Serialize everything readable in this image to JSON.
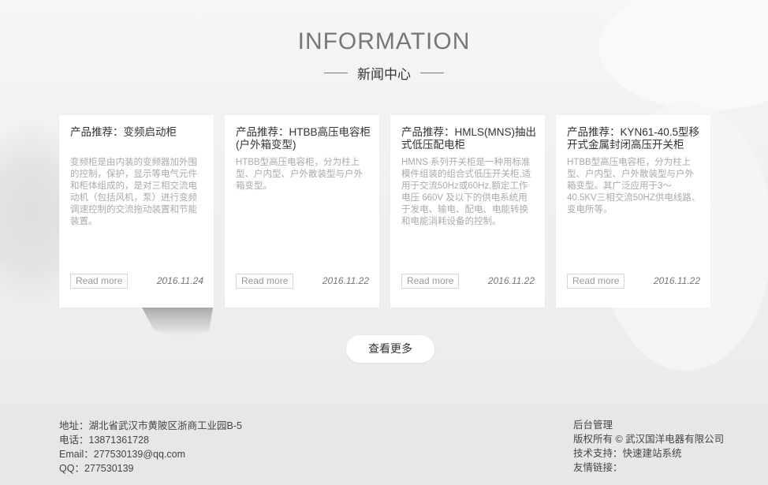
{
  "section": {
    "heading": "INFORMATION",
    "subheading": "新闻中心"
  },
  "cards": [
    {
      "title": "产品推荐：变频启动柜",
      "description": "变频柜是由内装的变频器加外围的控制，保护，显示等电气元件和柜体组成的，是对三相交流电动机（包括风机，泵）进行变频调速控制的交流拖动装置和节能装置。",
      "read_more": "Read more",
      "date": "2016.11.24"
    },
    {
      "title": "产品推荐：HTBB高压电容柜(户外箱变型)",
      "description": "HTBB型高压电容柜，分为柱上型、户内型、户外散装型与户外箱变型。",
      "read_more": "Read more",
      "date": "2016.11.22"
    },
    {
      "title": "产品推荐：HMLS(MNS)抽出式低压配电柜",
      "description": "HMNS 系列开关柜是一种用标准模件组装的组合式低压开关柜,适用于交流50Hz或60Hz,额定工作电压 660V 及以下的供电系统用于发电、输电、配电、电能转换和电能消耗设备的控制。",
      "read_more": "Read more",
      "date": "2016.11.22"
    },
    {
      "title": "产品推荐：KYN61-40.5型移开式金属封闭高压开关柜",
      "description": "HTBB型高压电容柜，分为柱上型、户内型、户外散装型与户外箱变型。其广泛应用于3～40.5KV三相交流50HZ供电线路、变电所等。",
      "read_more": "Read more",
      "date": "2016.11.22"
    }
  ],
  "more_button": "查看更多",
  "footer": {
    "left": [
      "地址：湖北省武汉市黄陂区浙商工业园B-5",
      "电话：13871361728",
      "Email：277530139@qq.com",
      "QQ：277530139"
    ],
    "right": [
      "后台管理",
      "版权所有 © 武汉国洋电器有限公司",
      "技术支持：快速建站系统",
      "友情链接："
    ]
  },
  "colors": {
    "heading": "#777777",
    "footer_bg": "#e7e7e7",
    "card_bg": "#ffffff"
  }
}
